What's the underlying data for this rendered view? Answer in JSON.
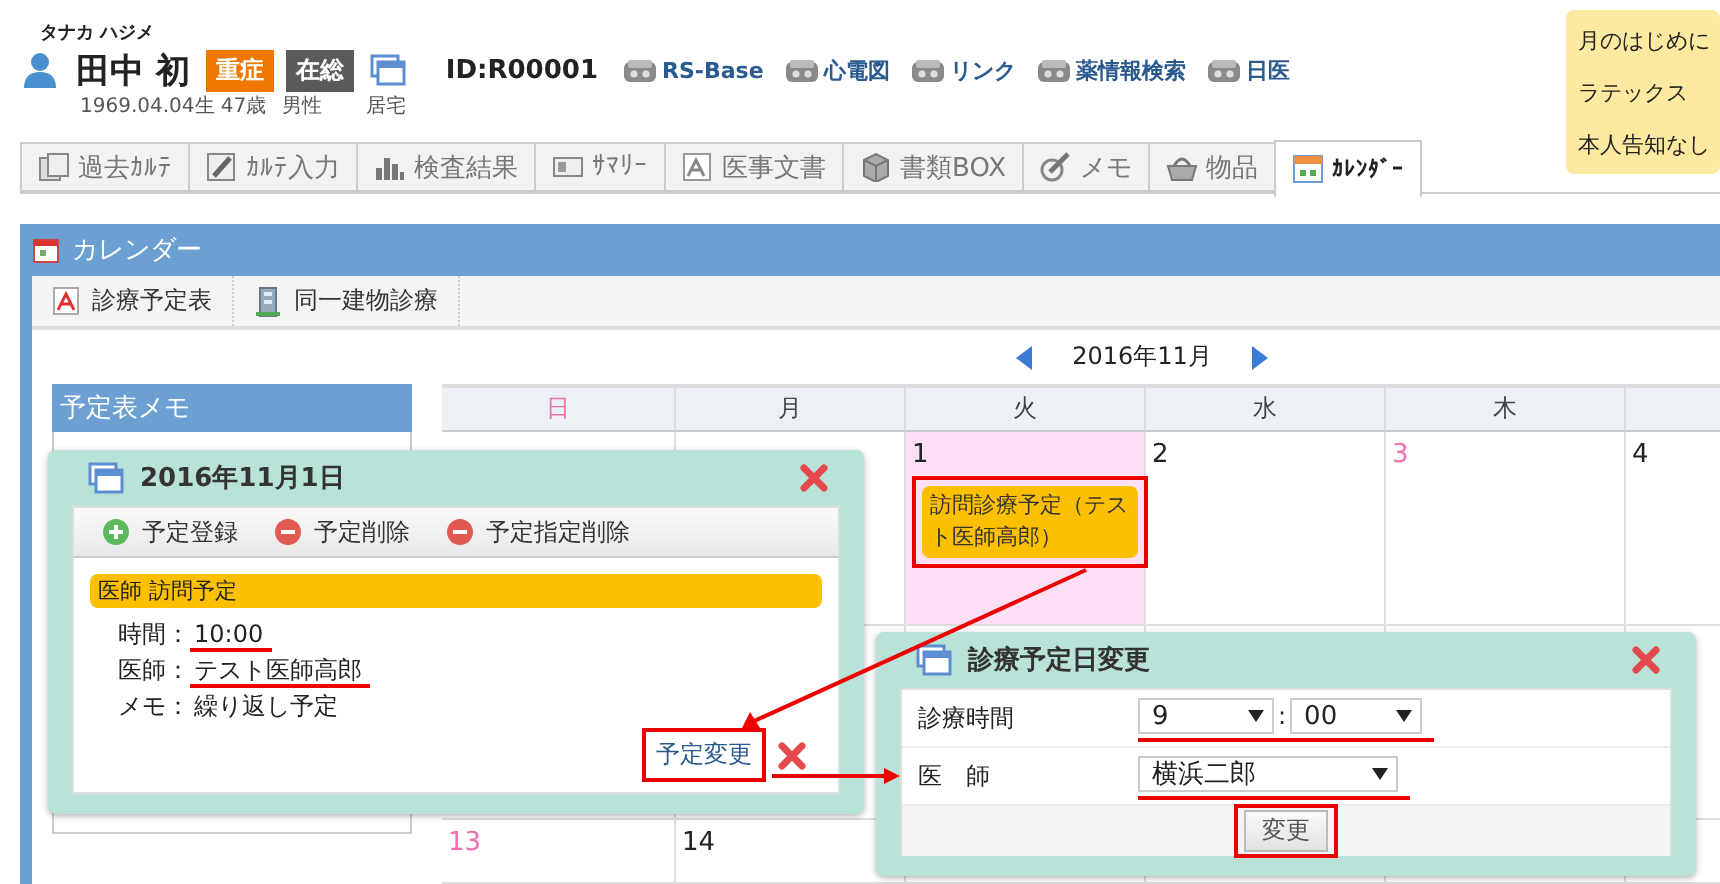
{
  "patient": {
    "kana": "タナカ ハジメ",
    "name": "田中 初",
    "badges": [
      {
        "label": "重症",
        "color": "#f07800"
      },
      {
        "label": "在総",
        "color": "#5a5a5a"
      }
    ],
    "id": "ID:R00001",
    "birth": "1969.04.04生 47歳",
    "sex": "男性",
    "residence": "居宅"
  },
  "links": [
    "RS-Base",
    "心電図",
    "リンク",
    "薬情報検索",
    "日医"
  ],
  "notes": [
    "月のはじめに",
    "ラテックス",
    "本人告知なし"
  ],
  "tabs": [
    {
      "label": "過去ｶﾙﾃ",
      "kind": "history",
      "selected": false
    },
    {
      "label": "ｶﾙﾃ入力",
      "kind": "edit",
      "selected": false
    },
    {
      "label": "検査結果",
      "kind": "chart",
      "selected": false
    },
    {
      "label": "ｻﾏﾘｰ",
      "kind": "summary",
      "selected": false
    },
    {
      "label": "医事文書",
      "kind": "pdf",
      "selected": false
    },
    {
      "label": "書類BOX",
      "kind": "box",
      "selected": false
    },
    {
      "label": "メモ",
      "kind": "memo",
      "selected": false
    },
    {
      "label": "物品",
      "kind": "goods",
      "selected": false
    },
    {
      "label": "ｶﾚﾝﾀﾞｰ",
      "kind": "calendar",
      "selected": true
    }
  ],
  "panel": {
    "title": "カレンダー",
    "toolbar": [
      {
        "label": "診療予定表",
        "kind": "pdf"
      },
      {
        "label": "同一建物診療",
        "kind": "building"
      }
    ],
    "month": "2016年11月",
    "memo_title": "予定表メモ",
    "weekdays": [
      {
        "label": "日",
        "kind": "holiday"
      },
      {
        "label": "月",
        "kind": "weekday"
      },
      {
        "label": "火",
        "kind": "weekday"
      },
      {
        "label": "水",
        "kind": "weekday"
      },
      {
        "label": "木",
        "kind": "weekday"
      }
    ],
    "weeks": [
      [
        {
          "selected": false
        },
        {
          "selected": false
        },
        {
          "day": "1",
          "kind": "weekday",
          "selected": true,
          "events": [
            {
              "label": "訪問診療予定（テスト医師高郎）",
              "highlighted": true
            }
          ]
        },
        {
          "day": "2",
          "kind": "weekday",
          "selected": false
        },
        {
          "day": "3",
          "kind": "holiday",
          "selected": false
        },
        {
          "day": "4",
          "kind": "weekday",
          "selected": false
        }
      ],
      [
        {
          "selected": false
        },
        {
          "selected": false
        },
        {
          "selected": false
        },
        {
          "selected": false
        },
        {
          "selected": false
        },
        {
          "selected": false
        }
      ],
      [
        {
          "day": "13",
          "kind": "holiday",
          "selected": false
        },
        {
          "day": "14",
          "kind": "weekday",
          "selected": false
        },
        {
          "selected": false
        },
        {
          "selected": false
        },
        {
          "selected": false
        },
        {
          "selected": false
        }
      ]
    ]
  },
  "day_popup": {
    "title": "2016年11月1日",
    "actions": [
      {
        "label": "予定登録",
        "kind": "add"
      },
      {
        "label": "予定削除",
        "kind": "delete"
      },
      {
        "label": "予定指定削除",
        "kind": "delete"
      }
    ],
    "event": "医師 訪問予定",
    "fields": [
      {
        "label": "時間：",
        "value": "10:00",
        "underlined": true
      },
      {
        "label": "医師：",
        "value": "テスト医師高郎",
        "underlined": true
      },
      {
        "label": "メモ：",
        "value": "繰り返し予定",
        "underlined": false
      }
    ],
    "link": {
      "label": "予定変更",
      "highlighted": true
    }
  },
  "change_popup": {
    "title": "診療予定日変更",
    "time_label": "診療時間",
    "hour": "9",
    "separator": ":",
    "minute": "00",
    "time_underlined": true,
    "doctor_label": "医　師",
    "doctor": "横浜二郎",
    "doctor_underlined": true,
    "button": {
      "label": "変更",
      "highlighted": true
    }
  }
}
